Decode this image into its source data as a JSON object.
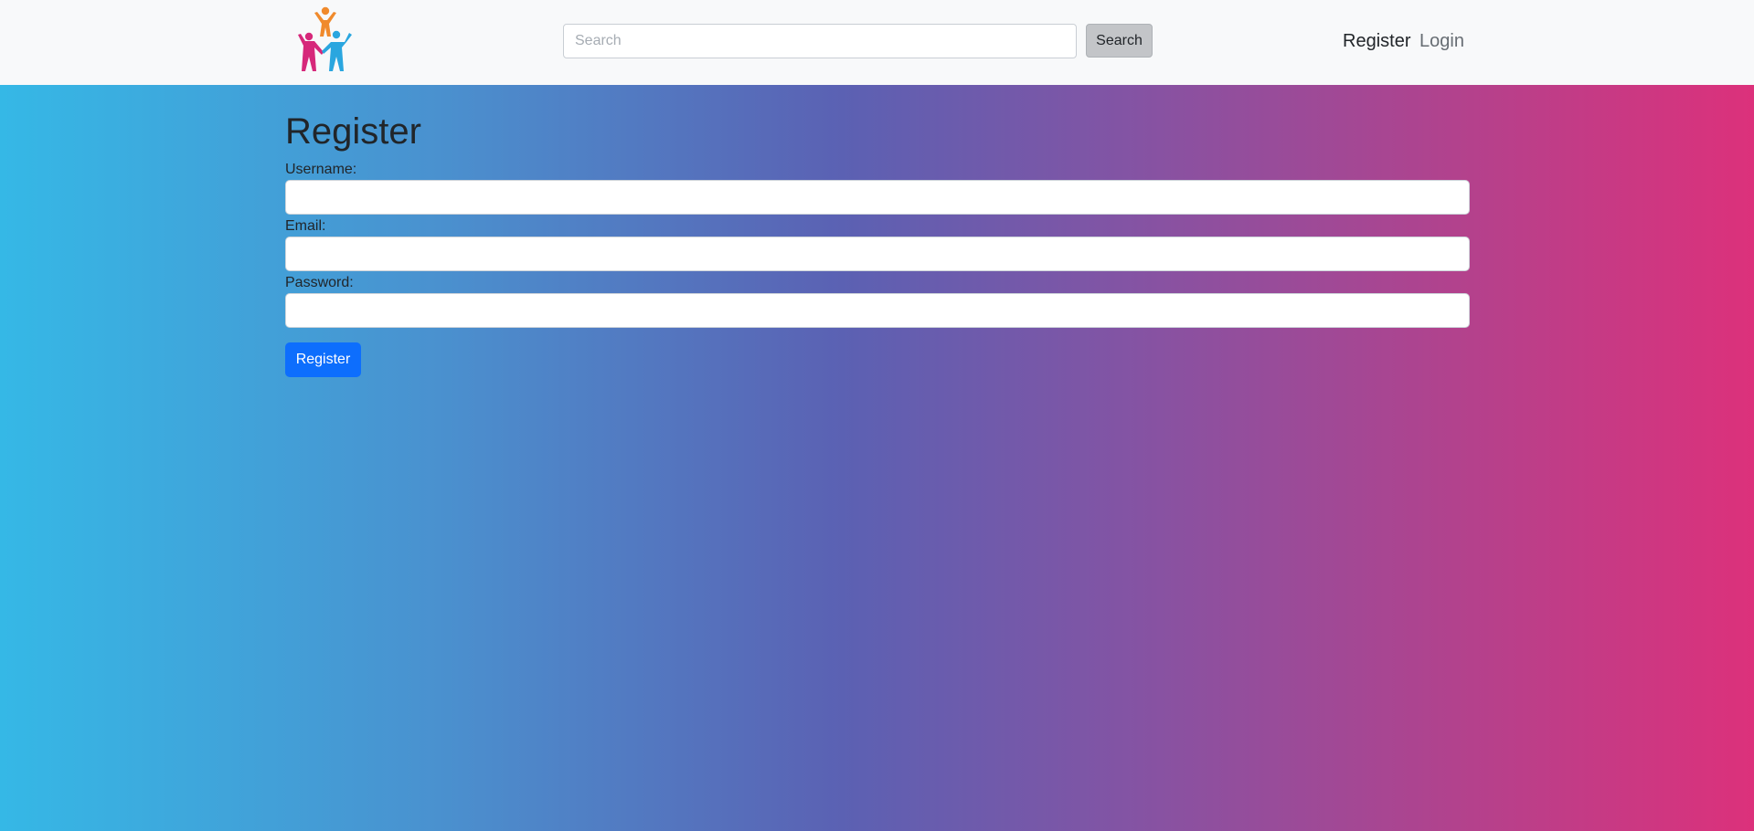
{
  "header": {
    "logo_icon": "people-celebrating-logo-icon",
    "search": {
      "placeholder": "Search",
      "value": "",
      "button_label": "Search"
    },
    "nav": {
      "register_label": "Register",
      "login_label": "Login"
    }
  },
  "form": {
    "title": "Register",
    "fields": [
      {
        "label": "Username:",
        "value": ""
      },
      {
        "label": "Email:",
        "value": ""
      },
      {
        "label": "Password:",
        "value": ""
      }
    ],
    "submit_label": "Register"
  },
  "colors": {
    "gradient_start": "#35b8e6",
    "gradient_mid": "#5b61b3",
    "gradient_end": "#dc317b",
    "primary_button": "#0d6efd",
    "navbar_bg": "#f8f9fa",
    "logo_orange": "#f08a2c",
    "logo_magenta": "#d6287a",
    "logo_blue": "#2aa6df"
  }
}
